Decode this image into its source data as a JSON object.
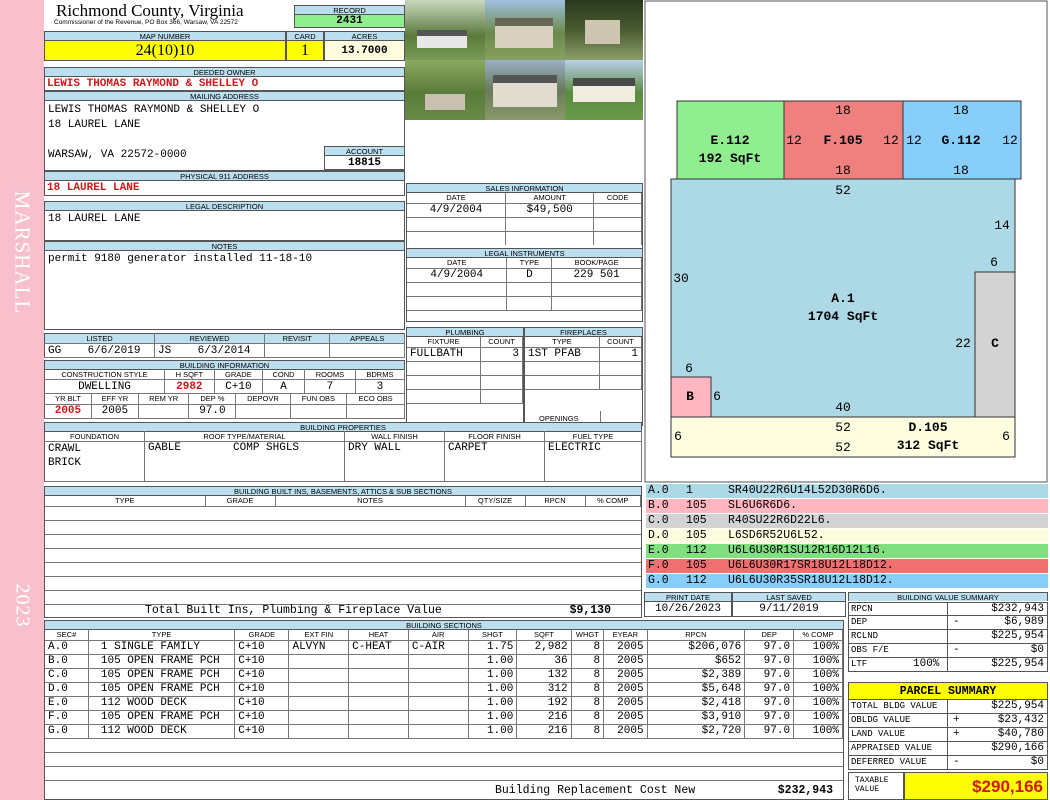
{
  "sidebar": {
    "name": "MARSHALL",
    "year": "2023"
  },
  "county": {
    "title": "Richmond County, Virginia",
    "subtitle": "Commissioner of the Revenue, PO Box 366, Warsaw, VA 22572"
  },
  "labels": {
    "record": "RECORD",
    "map_number": "MAP NUMBER",
    "card": "CARD",
    "acres": "ACRES",
    "deeded_owner": "DEEDED OWNER",
    "mailing_address": "MAILING ADDRESS",
    "account": "ACCOUNT",
    "physical_address": "PHYSICAL 911 ADDRESS",
    "legal_description": "LEGAL DESCRIPTION",
    "notes": "NOTES",
    "sales_information": "SALES INFORMATION",
    "legal_instruments": "LEGAL INSTRUMENTS",
    "plumbing": "PLUMBING",
    "fireplaces": "FIREPLACES",
    "openings": "OPENINGS",
    "listed": "LISTED",
    "reviewed": "REVIEWED",
    "revisit": "REVISIT",
    "appeals": "APPEALS",
    "building_information": "BUILDING INFORMATION",
    "building_properties": "BUILDING PROPERTIES",
    "built_ins": "BUILDING BUILT INS, BASEMENTS, ATTICS & SUB SECTIONS",
    "building_sections": "BUILDING SECTIONS",
    "print_date": "PRINT DATE",
    "last_saved": "LAST SAVED",
    "building_value_summary": "BUILDING VALUE SUMMARY",
    "parcel_summary": "PARCEL SUMMARY",
    "taxable_value_l1": "TAXABLE",
    "taxable_value_l2": "VALUE"
  },
  "record": "2431",
  "map_number": "24(10)10",
  "card": "1",
  "acres": "13.7000",
  "deeded_owner": "LEWIS THOMAS RAYMOND & SHELLEY O",
  "mailing": {
    "line1": "LEWIS THOMAS RAYMOND & SHELLEY O",
    "line2": "18 LAUREL LANE",
    "line3": "WARSAW, VA 22572-0000"
  },
  "account": "18815",
  "physical_address": "18 LAUREL LANE",
  "legal_description": "18 LAUREL LANE",
  "notes": "permit 9180 generator installed 11-18-10",
  "sales": {
    "headers": [
      "DATE",
      "AMOUNT",
      "CODE"
    ],
    "rows": [
      [
        "4/9/2004",
        "$49,500",
        ""
      ]
    ]
  },
  "instruments": {
    "headers": [
      "DATE",
      "TYPE",
      "BOOK/PAGE"
    ],
    "rows": [
      [
        "4/9/2004",
        "D",
        "229 501"
      ]
    ]
  },
  "plumbing": {
    "headers": [
      "FIXTURE",
      "COUNT"
    ],
    "rows": [
      [
        "FULLBATH",
        "3"
      ]
    ]
  },
  "fireplaces": {
    "headers": [
      "TYPE",
      "COUNT"
    ],
    "rows": [
      [
        "1ST PFAB",
        "1"
      ]
    ]
  },
  "listed": {
    "by": "GG",
    "date": "6/6/2019"
  },
  "reviewed": {
    "by": "JS",
    "date": "6/3/2014"
  },
  "building_info": {
    "h1": [
      "CONSTRUCTION STYLE",
      "H SQFT",
      "GRADE",
      "COND",
      "ROOMS",
      "BDRMS"
    ],
    "v1": [
      "DWELLING",
      "2982",
      "C+10",
      "A",
      "7",
      "3"
    ],
    "h2": [
      "YR BLT",
      "EFF YR",
      "REM YR",
      "DEP %",
      "DEPOVR",
      "FUN OBS",
      "ECO OBS"
    ],
    "v2": [
      "2005",
      "2005",
      "",
      "97.0",
      "",
      "",
      ""
    ]
  },
  "properties": {
    "headers": [
      "FOUNDATION",
      "ROOF TYPE/MATERIAL",
      "WALL FINISH",
      "FLOOR FINISH",
      "FUEL TYPE"
    ],
    "foundation": [
      "CRAWL",
      "BRICK"
    ],
    "roof_type": "GABLE",
    "roof_material": "COMP SHGLS",
    "wall": "DRY WALL",
    "floor": "CARPET",
    "fuel": "ELECTRIC"
  },
  "built_ins": {
    "headers": [
      "TYPE",
      "GRADE",
      "NOTES",
      "QTY/SIZE",
      "RPCN",
      "% COMP"
    ],
    "total_label": "Total Built Ins, Plumbing & Fireplace Value",
    "total_value": "$9,130"
  },
  "dates": {
    "print": "10/26/2023",
    "saved": "9/11/2019"
  },
  "sections": {
    "headers": [
      "SEC#",
      "TYPE",
      "GRADE",
      "EXT FIN",
      "HEAT",
      "AIR",
      "SHGT",
      "SQFT",
      "WHGT",
      "EYEAR",
      "RPCN",
      "DEP",
      "% COMP"
    ],
    "rows": [
      [
        "A.0",
        "1 SINGLE FAMILY",
        "C+10",
        "ALVYN",
        "C-HEAT",
        "C-AIR",
        "1.75",
        "2,982",
        "8",
        "2005",
        "$206,076",
        "97.0",
        "100%"
      ],
      [
        "B.0",
        "105 OPEN FRAME PCH",
        "C+10",
        "",
        "",
        "",
        "1.00",
        "36",
        "8",
        "2005",
        "$652",
        "97.0",
        "100%"
      ],
      [
        "C.0",
        "105 OPEN FRAME PCH",
        "C+10",
        "",
        "",
        "",
        "1.00",
        "132",
        "8",
        "2005",
        "$2,389",
        "97.0",
        "100%"
      ],
      [
        "D.0",
        "105 OPEN FRAME PCH",
        "C+10",
        "",
        "",
        "",
        "1.00",
        "312",
        "8",
        "2005",
        "$5,648",
        "97.0",
        "100%"
      ],
      [
        "E.0",
        "112 WOOD DECK",
        "C+10",
        "",
        "",
        "",
        "1.00",
        "192",
        "8",
        "2005",
        "$2,418",
        "97.0",
        "100%"
      ],
      [
        "F.0",
        "105 OPEN FRAME PCH",
        "C+10",
        "",
        "",
        "",
        "1.00",
        "216",
        "8",
        "2005",
        "$3,910",
        "97.0",
        "100%"
      ],
      [
        "G.0",
        "112 WOOD DECK",
        "C+10",
        "",
        "",
        "",
        "1.00",
        "216",
        "8",
        "2005",
        "$2,720",
        "97.0",
        "100%"
      ]
    ],
    "replacement_label": "Building Replacement Cost New",
    "replacement_value": "$232,943"
  },
  "sketch": {
    "A": {
      "label": "A.1",
      "area": "1704 SqFt",
      "dims": [
        "52",
        "14",
        "6",
        "22",
        "40",
        "6",
        "6",
        "30"
      ],
      "color": "#add8e6"
    },
    "B": {
      "label": "B",
      "color": "#ffb6c1"
    },
    "C": {
      "label": "C",
      "color": "#d3d3d3"
    },
    "D": {
      "label": "D.105",
      "area": "312 SqFt",
      "dims": [
        "52",
        "52",
        "6",
        "6"
      ],
      "color": "#fffde0"
    },
    "E": {
      "label": "E.112",
      "area": "192 SqFt",
      "dims": [
        "12"
      ],
      "color": "#90ee90"
    },
    "F": {
      "label": "F.105",
      "dims": [
        "18",
        "18",
        "12",
        "12"
      ],
      "color": "#f08080"
    },
    "G": {
      "label": "G.112",
      "dims": [
        "18",
        "18",
        "12",
        "12"
      ],
      "color": "#87cefa"
    }
  },
  "codes": [
    {
      "sec": "A.0",
      "code": "1",
      "path": "SR40U22R6U14L52D30R6D6.",
      "color": "#add8e6",
      "text": "#000"
    },
    {
      "sec": "B.0",
      "code": "105",
      "path": "SL6U6R6D6.",
      "color": "#ffb6c1",
      "text": "#000"
    },
    {
      "sec": "C.0",
      "code": "105",
      "path": "R40SU22R6D22L6.",
      "color": "#d3d3d3",
      "text": "#000"
    },
    {
      "sec": "D.0",
      "code": "105",
      "path": "L6SD6R52U6L52.",
      "color": "#fffde0",
      "text": "#000"
    },
    {
      "sec": "E.0",
      "code": "112",
      "path": "U6L6U30R1SU12R16D12L16.",
      "color": "#7ee07e",
      "text": "#000"
    },
    {
      "sec": "F.0",
      "code": "105",
      "path": "U6L6U30R17SR18U12L18D12.",
      "color": "#f07070",
      "text": "#000"
    },
    {
      "sec": "G.0",
      "code": "112",
      "path": "U6L6U30R35SR18U12L18D12.",
      "color": "#87cefa",
      "text": "#000"
    }
  ],
  "value_summary": [
    {
      "label": "RPCN",
      "sign": "",
      "value": "$232,943"
    },
    {
      "label": "DEP",
      "sign": "-",
      "value": "$6,989"
    },
    {
      "label": "RCLND",
      "sign": "",
      "value": "$225,954"
    },
    {
      "label": "OBS F/E",
      "sign": "-",
      "value": "$0"
    },
    {
      "label": "LTF",
      "pct": "100%",
      "sign": "",
      "value": "$225,954"
    }
  ],
  "parcel_summary": [
    {
      "label": "TOTAL BLDG VALUE",
      "sign": "",
      "value": "$225,954"
    },
    {
      "label": "OBLDG VALUE",
      "sign": "+",
      "value": "$23,432"
    },
    {
      "label": "LAND VALUE",
      "sign": "+",
      "value": "$40,780"
    },
    {
      "label": "APPRAISED VALUE",
      "sign": "",
      "value": "$290,166"
    },
    {
      "label": "DEFERRED VALUE",
      "sign": "-",
      "value": "$0"
    }
  ],
  "taxable_value": "$290,166"
}
